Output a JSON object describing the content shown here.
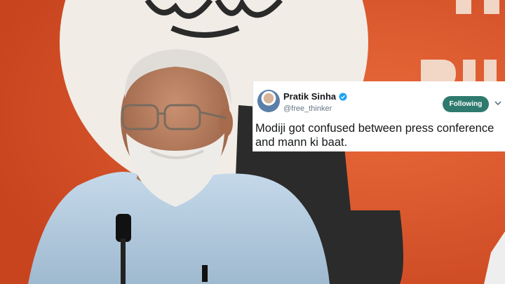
{
  "tweet": {
    "display_name": "Pratik Sinha",
    "handle": "@free_thinker",
    "follow_label": "Following",
    "text": "Modiji got confused between press conference and mann ki baat."
  },
  "icons": [
    "verified-badge-icon",
    "chevron-down-icon",
    "avatar"
  ],
  "colors": {
    "background_orange": "#d9532a",
    "following_button": "#2f7a6e",
    "verified_blue": "#1da1f2"
  }
}
